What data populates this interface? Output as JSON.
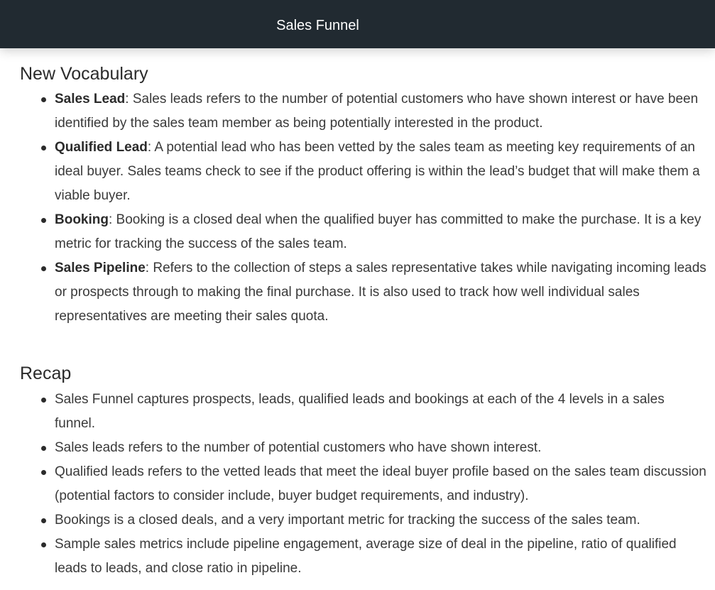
{
  "header": {
    "title": "Sales Funnel"
  },
  "vocabulary": {
    "heading": "New Vocabulary",
    "items": [
      {
        "term": "Sales Lead",
        "definition": ": Sales leads refers to the number of potential customers who have shown interest or have been identified by the sales team member as being potentially interested in the product."
      },
      {
        "term": "Qualified Lead",
        "definition": ": A potential lead who has been vetted by the sales team as meeting key requirements of an ideal buyer. Sales teams check to see if the product offering is within the lead’s budget that will make them a viable buyer."
      },
      {
        "term": "Booking",
        "definition": ": Booking is a closed deal when the qualified buyer has committed to make the purchase. It is a key metric for tracking the success of the sales team."
      },
      {
        "term": "Sales Pipeline",
        "definition": ": Refers to the collection of steps a sales representative takes while navigating incoming leads or prospects through to making the final purchase. It is also used to track how well individual sales representatives are meeting their sales quota."
      }
    ]
  },
  "recap": {
    "heading": "Recap",
    "items": [
      "Sales Funnel captures prospects, leads, qualified leads and bookings at each of the 4 levels in a sales funnel.",
      "Sales leads refers to the number of potential customers who have shown interest.",
      "Qualified leads refers to the vetted leads that meet the ideal buyer profile based on the sales team discussion (potential factors to consider include, buyer budget requirements, and industry).",
      "Bookings is a closed deals, and a very important metric for tracking the success of the sales team.",
      "Sample sales metrics include pipeline engagement, average size of deal in the pipeline, ratio of qualified leads to leads, and close ratio in pipeline."
    ]
  }
}
